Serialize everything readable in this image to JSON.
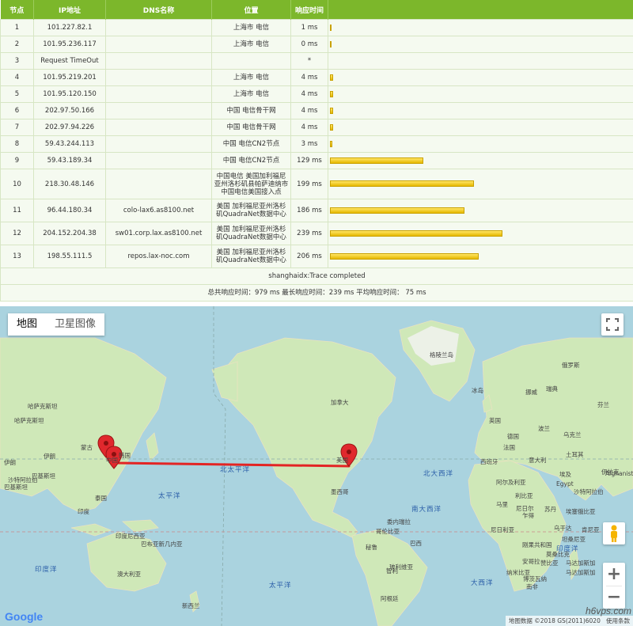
{
  "table": {
    "headers": [
      "节点",
      "IP地址",
      "DNS名称",
      "位置",
      "响应时间",
      ""
    ],
    "rows": [
      {
        "hop": "1",
        "ip": "101.227.82.1",
        "dns": "",
        "loc": "上海市 电信",
        "rt": "1 ms",
        "ms": 1
      },
      {
        "hop": "2",
        "ip": "101.95.236.117",
        "dns": "",
        "loc": "上海市 电信",
        "rt": "0 ms",
        "ms": 0
      },
      {
        "hop": "3",
        "ip": "Request TimeOut",
        "dns": "",
        "loc": "",
        "rt": "*",
        "ms": 0
      },
      {
        "hop": "4",
        "ip": "101.95.219.201",
        "dns": "",
        "loc": "上海市 电信",
        "rt": "4 ms",
        "ms": 4
      },
      {
        "hop": "5",
        "ip": "101.95.120.150",
        "dns": "",
        "loc": "上海市 电信",
        "rt": "4 ms",
        "ms": 4
      },
      {
        "hop": "6",
        "ip": "202.97.50.166",
        "dns": "",
        "loc": "中国 电信骨干网",
        "rt": "4 ms",
        "ms": 4
      },
      {
        "hop": "7",
        "ip": "202.97.94.226",
        "dns": "",
        "loc": "中国 电信骨干网",
        "rt": "4 ms",
        "ms": 4
      },
      {
        "hop": "8",
        "ip": "59.43.244.113",
        "dns": "",
        "loc": "中国 电信CN2节点",
        "rt": "3 ms",
        "ms": 3
      },
      {
        "hop": "9",
        "ip": "59.43.189.34",
        "dns": "",
        "loc": "中国 电信CN2节点",
        "rt": "129 ms",
        "ms": 129
      },
      {
        "hop": "10",
        "ip": "218.30.48.146",
        "dns": "",
        "loc": "中国电信 美国加利福尼亚州洛杉矶县帕萨迪纳市中国电信美国接入点",
        "rt": "199 ms",
        "ms": 199
      },
      {
        "hop": "11",
        "ip": "96.44.180.34",
        "dns": "colo-lax6.as8100.net",
        "loc": "美国 加利福尼亚州洛杉矶QuadraNet数据中心",
        "rt": "186 ms",
        "ms": 186
      },
      {
        "hop": "12",
        "ip": "204.152.204.38",
        "dns": "sw01.corp.lax.as8100.net",
        "loc": "美国 加利福尼亚州洛杉矶QuadraNet数据中心",
        "rt": "239 ms",
        "ms": 239
      },
      {
        "hop": "13",
        "ip": "198.55.111.5",
        "dns": "repos.lax-noc.com",
        "loc": "美国 加利福尼亚州洛杉矶QuadraNet数据中心",
        "rt": "206 ms",
        "ms": 206
      }
    ],
    "trace_status": "shanghaidx:Trace completed",
    "summary": "总共响应时间：979 ms     最长响应时间：239 ms     平均响应时间： 75 ms"
  },
  "map": {
    "type_map": "地图",
    "type_satellite": "卫星图像",
    "labels": [
      "格陵兰岛",
      "冰岛",
      "加拿大",
      "美国",
      "墨西哥",
      "委内瑞拉",
      "哥伦比亚",
      "秘鲁",
      "玻利维亚",
      "巴西",
      "阿根廷",
      "智利",
      "蒙古",
      "哈萨克斯坦",
      "中国",
      "韩国",
      "泰国",
      "印度尼西亚",
      "巴布亚新几内亚",
      "澳大利亚",
      "新西兰",
      "俄罗斯",
      "挪威",
      "英国",
      "德国",
      "西班牙",
      "阿尔及利亚",
      "利比亚",
      "埃及",
      "马里",
      "尼日尔",
      "苏丹",
      "乌干达",
      "刚果共和国",
      "安哥拉",
      "纳米比亚",
      "南非",
      "马达加斯加",
      "沙特阿拉伯",
      "Afghanistan",
      "巴基斯坦",
      "伊朗",
      "伊拉克",
      "土耳其",
      "芬兰",
      "瑞典",
      "法国",
      "意大利",
      "乌克兰",
      "波兰",
      "Egypt",
      "印度",
      "哈萨克斯坦",
      "伊朗",
      "巴基斯坦",
      "沙特阿拉伯",
      "乍得",
      "尼日利亚",
      "埃塞俄比亚",
      "肯尼亚",
      "坦桑尼亚",
      "莫桑比克",
      "博茨瓦纳",
      "赞比亚",
      "马达加斯加"
    ],
    "oceans": [
      "北太平洋",
      "北大西洋",
      "印度洋",
      "太平洋",
      "大西洋",
      "印度洋",
      "太平洋",
      "南大西洋"
    ],
    "attribution": "地图数据 ©2018 GS(2011)6020",
    "terms": "使用条款",
    "google": "Google",
    "watermark": "h6vps.com",
    "zoom_in": "+",
    "zoom_out": "−"
  }
}
